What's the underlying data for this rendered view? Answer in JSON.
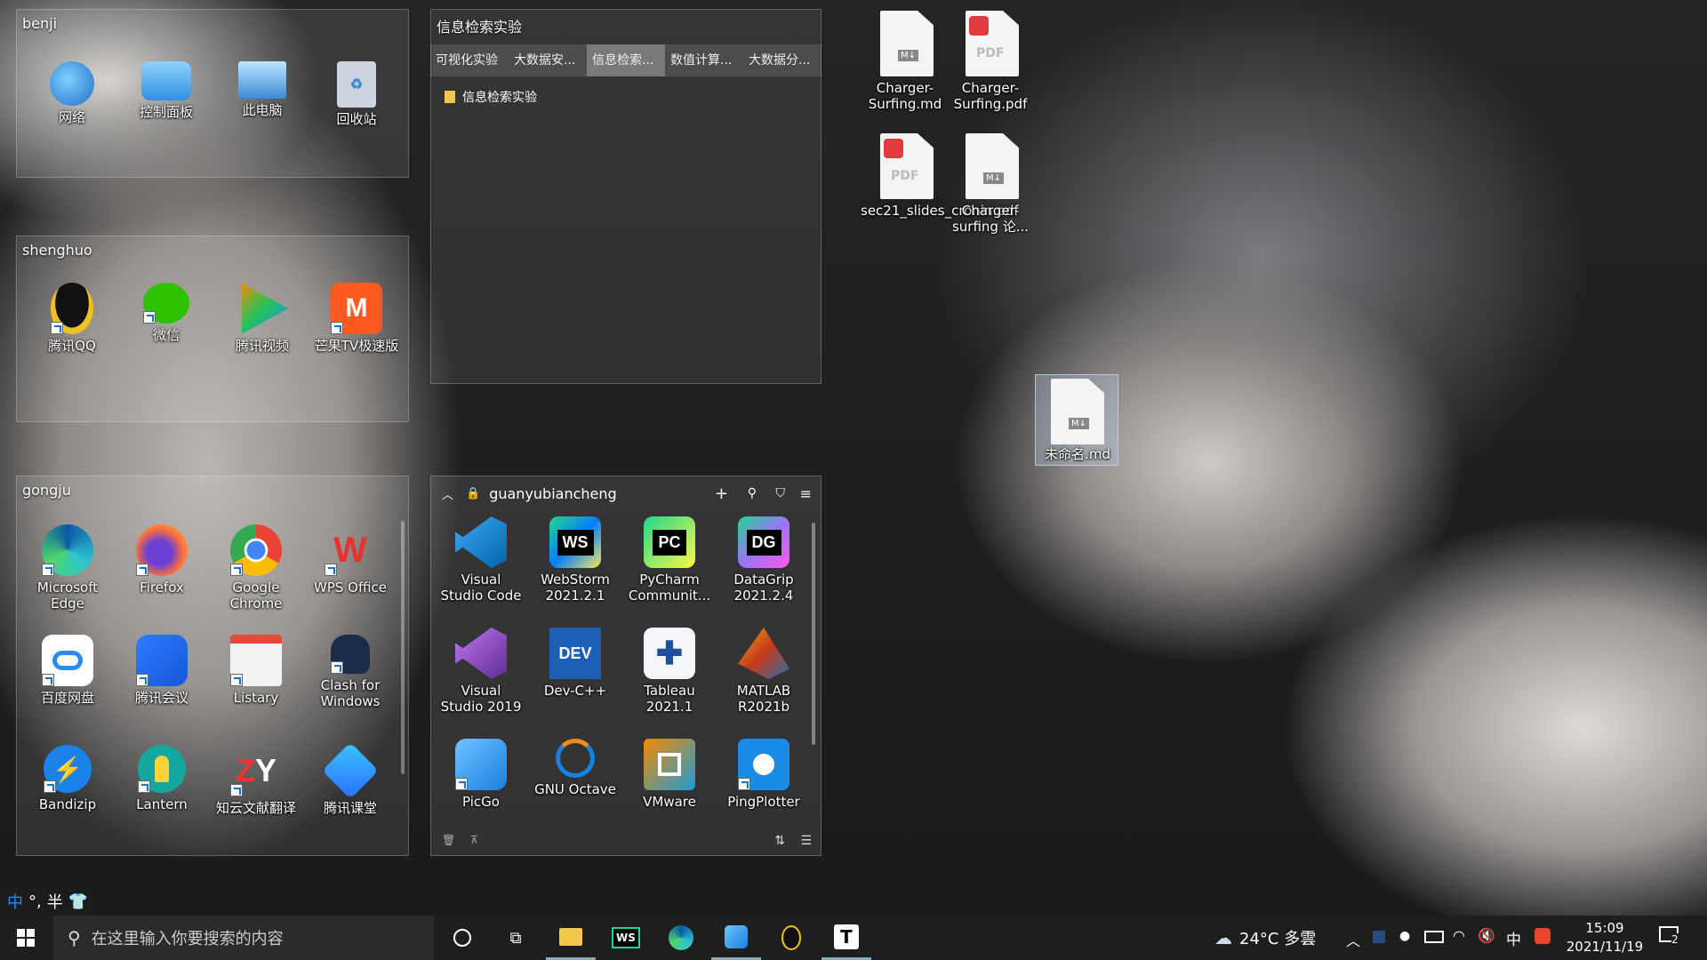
{
  "fences": {
    "benji": {
      "title": "benji",
      "items": [
        {
          "label": "网络",
          "icon": "network-icon"
        },
        {
          "label": "控制面板",
          "icon": "control-panel-icon"
        },
        {
          "label": "此电脑",
          "icon": "this-pc-icon"
        },
        {
          "label": "回收站",
          "icon": "recycle-bin-icon"
        }
      ]
    },
    "shenghuo": {
      "title": "shenghuo",
      "items": [
        {
          "label": "腾讯QQ",
          "icon": "qq-icon"
        },
        {
          "label": "微信",
          "icon": "wechat-icon"
        },
        {
          "label": "腾讯视频",
          "icon": "tencent-video-icon"
        },
        {
          "label": "芒果TV极速版",
          "icon": "mango-tv-icon"
        }
      ]
    },
    "gongju": {
      "title": "gongju",
      "items": [
        {
          "label": "Microsoft Edge",
          "icon": "edge-icon"
        },
        {
          "label": "Firefox",
          "icon": "firefox-icon"
        },
        {
          "label": "Google Chrome",
          "icon": "chrome-icon"
        },
        {
          "label": "WPS Office",
          "icon": "wps-icon"
        },
        {
          "label": "百度网盘",
          "icon": "baidu-netdisk-icon"
        },
        {
          "label": "腾讯会议",
          "icon": "tencent-meeting-icon"
        },
        {
          "label": "Listary",
          "icon": "listary-icon"
        },
        {
          "label": "Clash for Windows",
          "icon": "clash-icon"
        },
        {
          "label": "Bandizip",
          "icon": "bandizip-icon"
        },
        {
          "label": "Lantern",
          "icon": "lantern-icon"
        },
        {
          "label": "知云文献翻译",
          "icon": "zhiyun-icon"
        },
        {
          "label": "腾讯课堂",
          "icon": "tencent-classroom-icon"
        }
      ]
    },
    "xinxi": {
      "title": "信息检索实验",
      "tabs": [
        "可视化实验",
        "大数据安...",
        "信息检索...",
        "数值计算...",
        "大数据分..."
      ],
      "folder": "信息检索实验"
    },
    "guanyu": {
      "title": "guanyubiancheng",
      "items": [
        {
          "label": "Visual Studio Code",
          "icon": "vscode-icon"
        },
        {
          "label": "WebStorm 2021.2.1",
          "icon": "webstorm-icon"
        },
        {
          "label": "PyCharm Communit...",
          "icon": "pycharm-icon"
        },
        {
          "label": "DataGrip 2021.2.4",
          "icon": "datagrip-icon"
        },
        {
          "label": "Visual Studio 2019",
          "icon": "visual-studio-icon"
        },
        {
          "label": "Dev-C++",
          "icon": "devcpp-icon"
        },
        {
          "label": "Tableau 2021.1",
          "icon": "tableau-icon"
        },
        {
          "label": "MATLAB R2021b",
          "icon": "matlab-icon"
        },
        {
          "label": "PicGo",
          "icon": "picgo-icon"
        },
        {
          "label": "GNU Octave",
          "icon": "octave-icon"
        },
        {
          "label": "VMware",
          "icon": "vmware-icon"
        },
        {
          "label": "PingPlotter",
          "icon": "pingplotter-icon"
        }
      ]
    }
  },
  "desktop_files": [
    {
      "label": "Charger-Surfing.md",
      "type": "md"
    },
    {
      "label": "Charger-Surfing.pdf",
      "type": "pdf"
    },
    {
      "label": "sec21_slides_cronin.pdf",
      "type": "pdf"
    },
    {
      "label": "Charger-surfing 论...",
      "type": "md"
    },
    {
      "label": "未命名.md",
      "type": "md"
    }
  ],
  "ime": {
    "mode": "中",
    "punct": "°,",
    "width": "半"
  },
  "taskbar": {
    "search_placeholder": "在这里输入你要搜索的内容",
    "weather": "24°C 多雲",
    "ime": "中",
    "time": "15:09",
    "date": "2021/11/19",
    "notifications": "2",
    "typora_letter": "T",
    "ws_letters": "WS"
  },
  "icon_letters": {
    "webstorm": "WS",
    "pycharm": "PC",
    "datagrip": "DG",
    "devcpp": "DEV",
    "zhiyun": "ZY",
    "pdf": "PDF",
    "md": "M↓"
  }
}
